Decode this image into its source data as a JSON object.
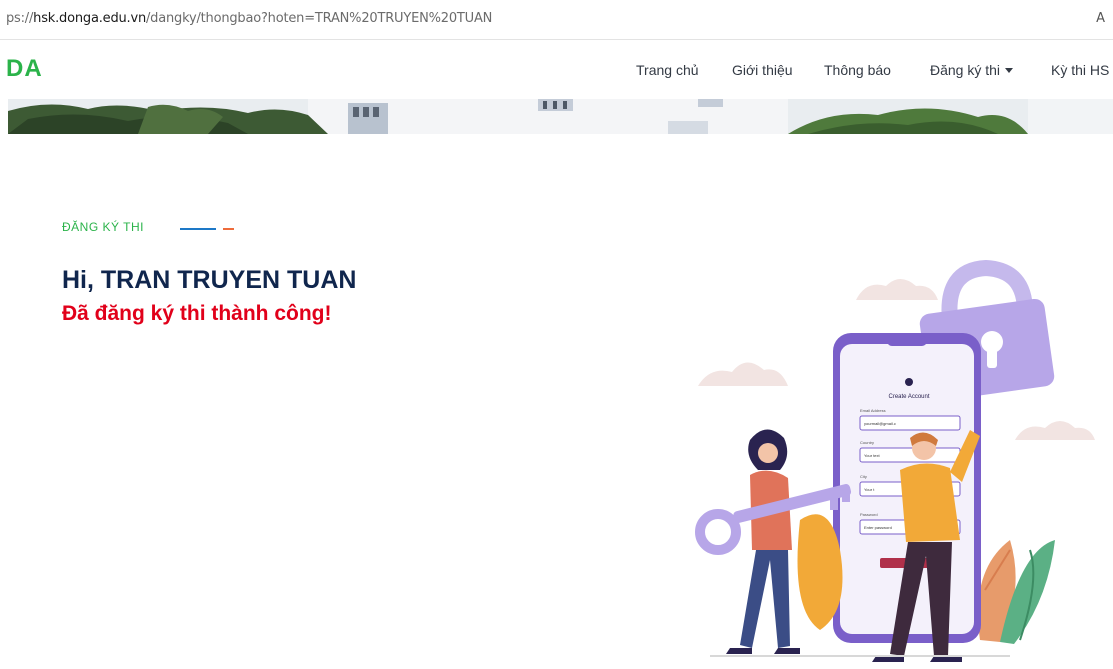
{
  "browser": {
    "url_prefix": "ps://",
    "url_host": "hsk.donga.edu.vn",
    "url_path": "/dangky/thongbao?hoten=TRAN%20TRUYEN%20TUAN",
    "reader_icon": "A"
  },
  "navbar": {
    "logo": "DA",
    "links": [
      {
        "label": "Trang chủ"
      },
      {
        "label": "Giới thiệu"
      },
      {
        "label": "Thông báo"
      },
      {
        "label": "Đăng ký thi",
        "dropdown": true
      },
      {
        "label": "Kỳ thi HS"
      }
    ]
  },
  "content": {
    "section_label": "ĐĂNG KÝ THI",
    "greeting": "Hi, TRAN TRUYEN TUAN",
    "status": "Đã đăng ký thi thành công!"
  },
  "illustration": {
    "form_title": "Create Account",
    "field_labels": [
      "Email Address",
      "Country",
      "City",
      "Password"
    ],
    "field_values": [
      "yourmail@gmail.c",
      "Your text",
      "Your t",
      "Enter password"
    ]
  },
  "colors": {
    "brand_green": "#2bb34a",
    "heading_navy": "#10264d",
    "success_red": "#e1001a",
    "accent_blue": "#1d78c7",
    "accent_orange": "#ee6b3b",
    "phone_purple": "#7a5fc9"
  }
}
